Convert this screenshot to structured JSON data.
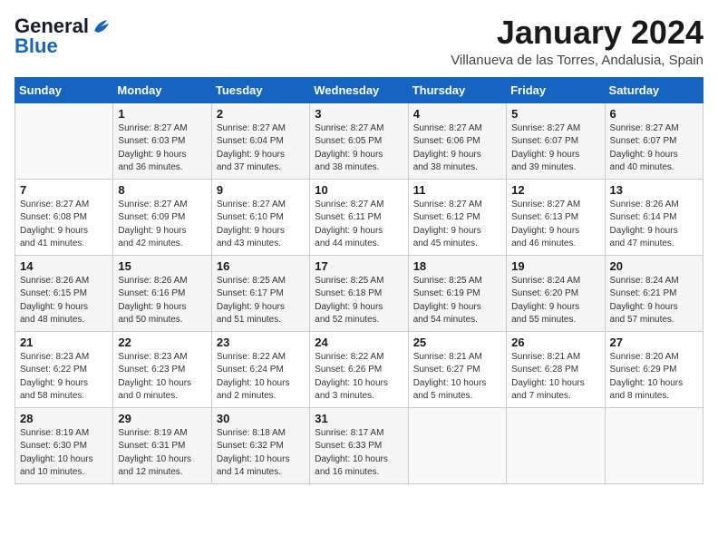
{
  "header": {
    "logo_line1": "General",
    "logo_line2": "Blue",
    "month_title": "January 2024",
    "location": "Villanueva de las Torres, Andalusia, Spain"
  },
  "weekdays": [
    "Sunday",
    "Monday",
    "Tuesday",
    "Wednesday",
    "Thursday",
    "Friday",
    "Saturday"
  ],
  "weeks": [
    [
      {
        "day": "",
        "info": ""
      },
      {
        "day": "1",
        "info": "Sunrise: 8:27 AM\nSunset: 6:03 PM\nDaylight: 9 hours\nand 36 minutes."
      },
      {
        "day": "2",
        "info": "Sunrise: 8:27 AM\nSunset: 6:04 PM\nDaylight: 9 hours\nand 37 minutes."
      },
      {
        "day": "3",
        "info": "Sunrise: 8:27 AM\nSunset: 6:05 PM\nDaylight: 9 hours\nand 38 minutes."
      },
      {
        "day": "4",
        "info": "Sunrise: 8:27 AM\nSunset: 6:06 PM\nDaylight: 9 hours\nand 38 minutes."
      },
      {
        "day": "5",
        "info": "Sunrise: 8:27 AM\nSunset: 6:07 PM\nDaylight: 9 hours\nand 39 minutes."
      },
      {
        "day": "6",
        "info": "Sunrise: 8:27 AM\nSunset: 6:07 PM\nDaylight: 9 hours\nand 40 minutes."
      }
    ],
    [
      {
        "day": "7",
        "info": "Sunrise: 8:27 AM\nSunset: 6:08 PM\nDaylight: 9 hours\nand 41 minutes."
      },
      {
        "day": "8",
        "info": "Sunrise: 8:27 AM\nSunset: 6:09 PM\nDaylight: 9 hours\nand 42 minutes."
      },
      {
        "day": "9",
        "info": "Sunrise: 8:27 AM\nSunset: 6:10 PM\nDaylight: 9 hours\nand 43 minutes."
      },
      {
        "day": "10",
        "info": "Sunrise: 8:27 AM\nSunset: 6:11 PM\nDaylight: 9 hours\nand 44 minutes."
      },
      {
        "day": "11",
        "info": "Sunrise: 8:27 AM\nSunset: 6:12 PM\nDaylight: 9 hours\nand 45 minutes."
      },
      {
        "day": "12",
        "info": "Sunrise: 8:27 AM\nSunset: 6:13 PM\nDaylight: 9 hours\nand 46 minutes."
      },
      {
        "day": "13",
        "info": "Sunrise: 8:26 AM\nSunset: 6:14 PM\nDaylight: 9 hours\nand 47 minutes."
      }
    ],
    [
      {
        "day": "14",
        "info": "Sunrise: 8:26 AM\nSunset: 6:15 PM\nDaylight: 9 hours\nand 48 minutes."
      },
      {
        "day": "15",
        "info": "Sunrise: 8:26 AM\nSunset: 6:16 PM\nDaylight: 9 hours\nand 50 minutes."
      },
      {
        "day": "16",
        "info": "Sunrise: 8:25 AM\nSunset: 6:17 PM\nDaylight: 9 hours\nand 51 minutes."
      },
      {
        "day": "17",
        "info": "Sunrise: 8:25 AM\nSunset: 6:18 PM\nDaylight: 9 hours\nand 52 minutes."
      },
      {
        "day": "18",
        "info": "Sunrise: 8:25 AM\nSunset: 6:19 PM\nDaylight: 9 hours\nand 54 minutes."
      },
      {
        "day": "19",
        "info": "Sunrise: 8:24 AM\nSunset: 6:20 PM\nDaylight: 9 hours\nand 55 minutes."
      },
      {
        "day": "20",
        "info": "Sunrise: 8:24 AM\nSunset: 6:21 PM\nDaylight: 9 hours\nand 57 minutes."
      }
    ],
    [
      {
        "day": "21",
        "info": "Sunrise: 8:23 AM\nSunset: 6:22 PM\nDaylight: 9 hours\nand 58 minutes."
      },
      {
        "day": "22",
        "info": "Sunrise: 8:23 AM\nSunset: 6:23 PM\nDaylight: 10 hours\nand 0 minutes."
      },
      {
        "day": "23",
        "info": "Sunrise: 8:22 AM\nSunset: 6:24 PM\nDaylight: 10 hours\nand 2 minutes."
      },
      {
        "day": "24",
        "info": "Sunrise: 8:22 AM\nSunset: 6:26 PM\nDaylight: 10 hours\nand 3 minutes."
      },
      {
        "day": "25",
        "info": "Sunrise: 8:21 AM\nSunset: 6:27 PM\nDaylight: 10 hours\nand 5 minutes."
      },
      {
        "day": "26",
        "info": "Sunrise: 8:21 AM\nSunset: 6:28 PM\nDaylight: 10 hours\nand 7 minutes."
      },
      {
        "day": "27",
        "info": "Sunrise: 8:20 AM\nSunset: 6:29 PM\nDaylight: 10 hours\nand 8 minutes."
      }
    ],
    [
      {
        "day": "28",
        "info": "Sunrise: 8:19 AM\nSunset: 6:30 PM\nDaylight: 10 hours\nand 10 minutes."
      },
      {
        "day": "29",
        "info": "Sunrise: 8:19 AM\nSunset: 6:31 PM\nDaylight: 10 hours\nand 12 minutes."
      },
      {
        "day": "30",
        "info": "Sunrise: 8:18 AM\nSunset: 6:32 PM\nDaylight: 10 hours\nand 14 minutes."
      },
      {
        "day": "31",
        "info": "Sunrise: 8:17 AM\nSunset: 6:33 PM\nDaylight: 10 hours\nand 16 minutes."
      },
      {
        "day": "",
        "info": ""
      },
      {
        "day": "",
        "info": ""
      },
      {
        "day": "",
        "info": ""
      }
    ]
  ]
}
